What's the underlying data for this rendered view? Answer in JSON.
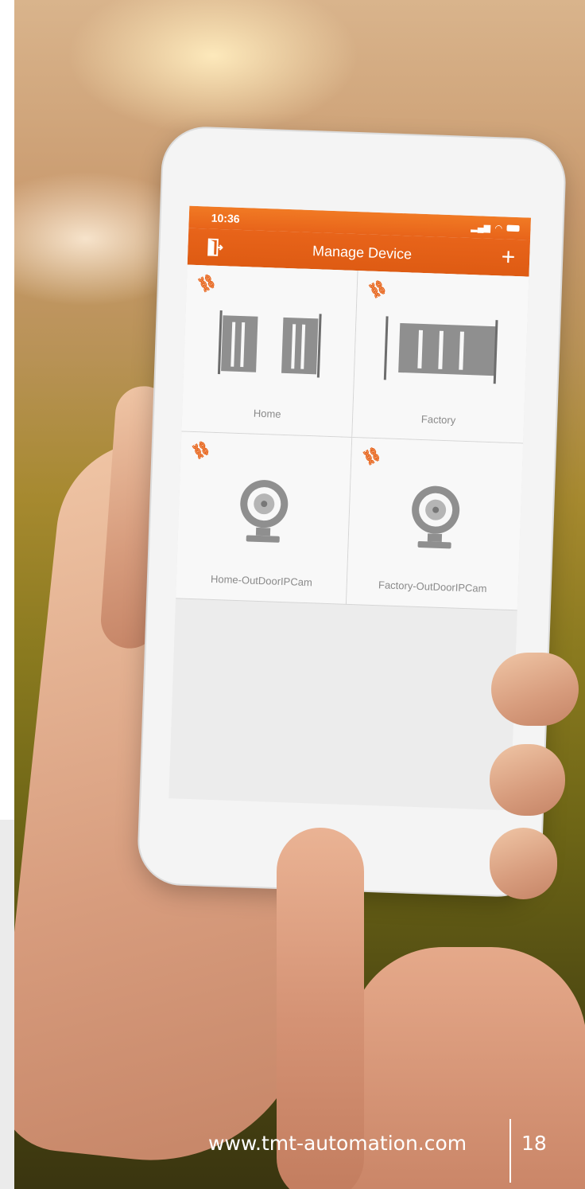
{
  "status_bar": {
    "time": "10:36"
  },
  "nav": {
    "title": "Manage Device",
    "add_label": "+"
  },
  "devices": [
    {
      "label": "Home",
      "icon": "gate-icon"
    },
    {
      "label": "Factory",
      "icon": "sliding-gate-icon"
    },
    {
      "label": "Home-OutDoorIPCam",
      "icon": "camera-icon"
    },
    {
      "label": "Factory-OutDoorIPCam",
      "icon": "camera-icon"
    }
  ],
  "footer": {
    "url": "www.tmt-automation.com",
    "page": "18"
  },
  "colors": {
    "accent": "#e8641a",
    "footer_text": "#ffffff"
  }
}
